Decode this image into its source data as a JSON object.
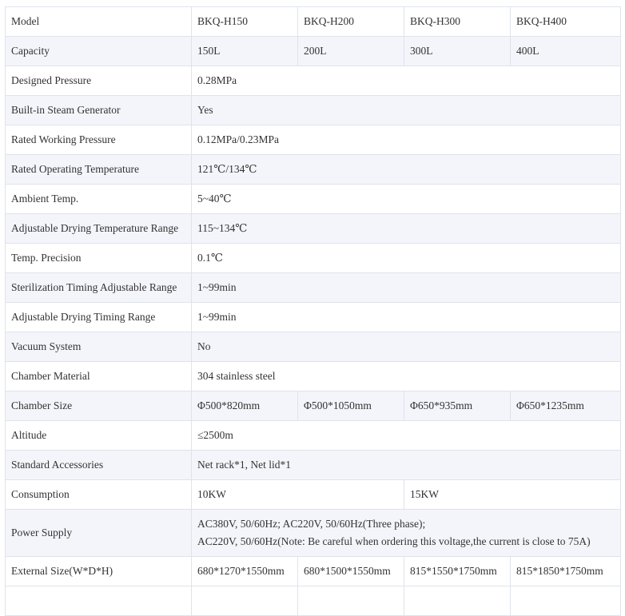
{
  "rows": [
    {
      "label": "Model",
      "cells": [
        "BKQ-H150",
        "BKQ-H200",
        "BKQ-H300",
        "BKQ-H400"
      ]
    },
    {
      "label": "Capacity",
      "cells": [
        "150L",
        "200L",
        "300L",
        "400L"
      ]
    },
    {
      "label": "Designed Pressure",
      "value": "0.28MPa"
    },
    {
      "label": "Built-in Steam Generator",
      "value": "Yes"
    },
    {
      "label": "Rated Working Pressure",
      "value": "0.12MPa/0.23MPa"
    },
    {
      "label": "Rated Operating Temperature",
      "value": "121℃/134℃"
    },
    {
      "label": "Ambient Temp.",
      "value": "5~40℃"
    },
    {
      "label": "Adjustable Drying Temperature Range",
      "value": "115~134℃"
    },
    {
      "label": "Temp. Precision",
      "value": "0.1℃"
    },
    {
      "label": "Sterilization Timing Adjustable Range",
      "value": "1~99min"
    },
    {
      "label": "Adjustable Drying Timing Range",
      "value": "1~99min"
    },
    {
      "label": "Vacuum System",
      "value": "No"
    },
    {
      "label": "Chamber Material",
      "value": "304 stainless steel"
    },
    {
      "label": "Chamber Size",
      "cells": [
        "Φ500*820mm",
        "Φ500*1050mm",
        "Φ650*935mm",
        "Φ650*1235mm"
      ]
    },
    {
      "label": "Altitude",
      "value": "≤2500m"
    },
    {
      "label": "Standard Accessories",
      "value": "Net rack*1, Net lid*1"
    },
    {
      "label": "Consumption",
      "cells": [
        "10KW",
        "15KW"
      ]
    },
    {
      "label": "Power Supply",
      "lines": [
        "AC380V, 50/60Hz; AC220V, 50/60Hz(Three phase);",
        "AC220V, 50/60Hz(Note: Be careful when ordering this voltage,the current is close to 75A)"
      ]
    },
    {
      "label": "External Size(W*D*H)",
      "cells": [
        "680*1270*1550mm",
        "680*1500*1550mm",
        "815*1550*1750mm",
        "815*1850*1750mm"
      ]
    }
  ]
}
